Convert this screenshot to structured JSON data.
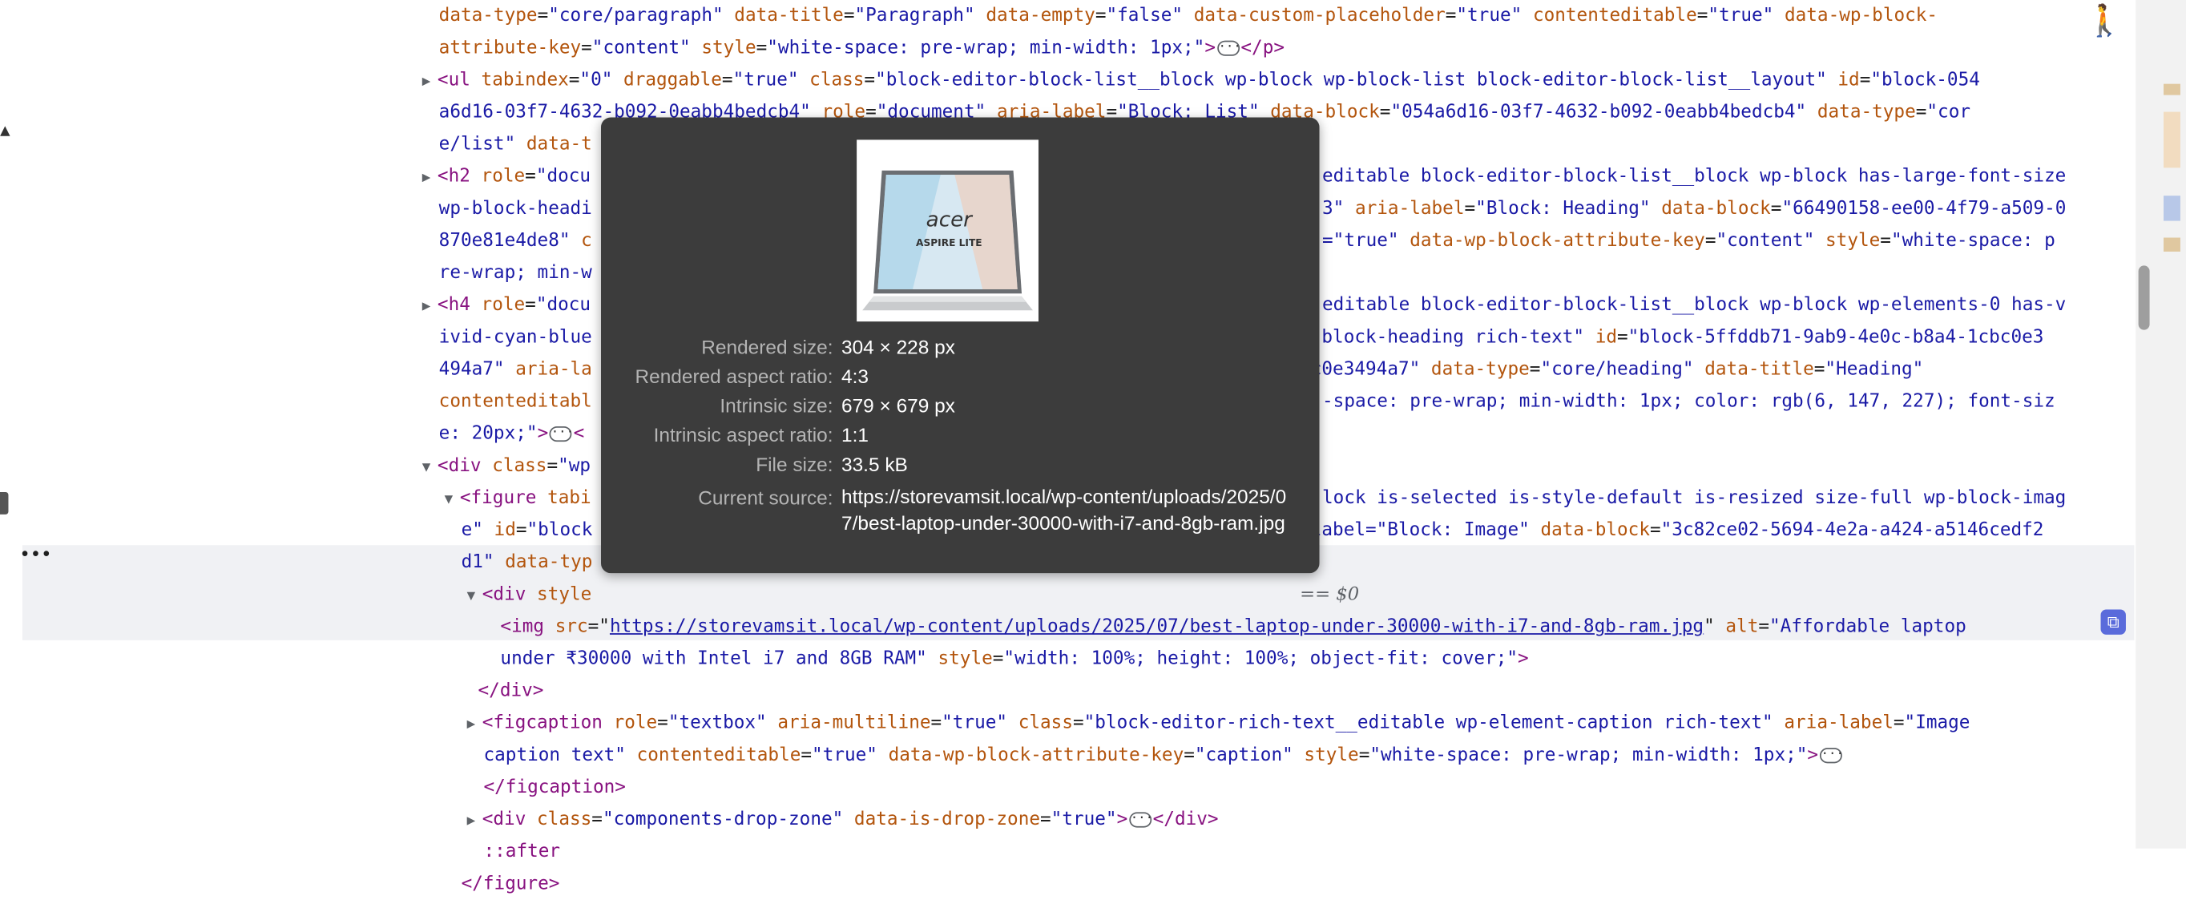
{
  "code": {
    "l1": {
      "a1": "data-type",
      "v1": "\"core/paragraph\"",
      "a2": "data-title",
      "v2": "\"Paragraph\"",
      "a3": "data-empty",
      "v3": "\"false\"",
      "a4": "data-custom-placeholder",
      "v4": "\"true\"",
      "a5": "contenteditable",
      "v5": "\"true\"",
      "a6": "data-wp-block-"
    },
    "l2": {
      "a1": "attribute-key",
      "v1": "\"content\"",
      "a2": "style",
      "v2": "\"white-space: pre-wrap; min-width: 1px;\"",
      "close": "</p>"
    },
    "l3": {
      "tag": "<ul",
      "a1": "tabindex",
      "v1": "\"0\"",
      "a2": "draggable",
      "v2": "\"true\"",
      "a3": "class",
      "v3": "\"block-editor-block-list__block wp-block wp-block-list block-editor-block-list__layout\"",
      "a4": "id",
      "v4": "\"block-054"
    },
    "l4": {
      "v0": "a6d16-03f7-4632-b092-0eabb4bedcb4\"",
      "a1": "role",
      "v1": "\"document\"",
      "a2": "aria-label",
      "v2": "\"Block: List\"",
      "a3": "data-block",
      "v3": "\"054a6d16-03f7-4632-b092-0eabb4bedcb4\"",
      "a4": "data-type",
      "v4": "\"cor"
    },
    "l5": {
      "v0": "e/list\"",
      "a1": "data-t"
    },
    "l6": {
      "tag": "<h2",
      "a1": "role",
      "v1": "\"docu",
      "v2": "editable block-editor-block-list__block wp-block has-large-font-size"
    },
    "l7": {
      "v0": "wp-block-headi",
      "v1": "3\"",
      "a2": "aria-label",
      "v2": "\"Block: Heading\"",
      "a3": "data-block",
      "v3": "\"66490158-ee00-4f79-a509-0"
    },
    "l8": {
      "v0": "870e81e4de8\"",
      "a1": "c",
      "v1": "=\"true\"",
      "a2": "data-wp-block-attribute-key",
      "v2": "\"content\"",
      "a3": "style",
      "v3": "\"white-space: p"
    },
    "l9": {
      "v0": "re-wrap; min-w"
    },
    "l10": {
      "tag": "<h4",
      "a1": "role",
      "v1": "\"docu",
      "v2": "editable block-editor-block-list__block wp-block wp-elements-0 has-v"
    },
    "l11": {
      "v0": "ivid-cyan-blue",
      "v1": "o-block-heading rich-text\"",
      "a2": "id",
      "v2": "\"block-5ffddb71-9ab9-4e0c-b8a4-1cbc0e3"
    },
    "l12": {
      "v0": "494a7\"",
      "a1": "aria-la",
      "v1": "bc0e3494a7\"",
      "a2": "data-type",
      "v2": "\"core/heading\"",
      "a3": "data-title",
      "v3": "\"Heading\""
    },
    "l13": {
      "a0": "contenteditabl",
      "v1": "-space: pre-wrap; min-width: 1px; color: rgb(6, 147, 227); font-siz"
    },
    "l14": {
      "v0": "e: 20px;\"",
      "close": "<"
    },
    "l15": {
      "tag": "<div",
      "a1": "class",
      "v1": "\"wp"
    },
    "l16": {
      "tag": "<figure",
      "a1": "tabi",
      "v1": "lock is-selected is-style-default is-resized size-full wp-block-imag"
    },
    "l17": {
      "v0": "e\"",
      "a1": "id",
      "v1": "\"block",
      "v2": "-label=\"Block: Image\"",
      "a3": "data-block",
      "v3": "\"3c82ce02-5694-4e2a-a424-a5146cedf2"
    },
    "l18": {
      "v0": "d1\"",
      "a1": "data-typ"
    },
    "l19": {
      "tag": "<div",
      "a1": "style",
      "eq": "== $0"
    },
    "l20": {
      "tag": "<img",
      "a1": "src",
      "link": "https://storevamsit.local/wp-content/uploads/2025/07/best-laptop-under-30000-with-i7-and-8gb-ram.jpg",
      "a2": "alt",
      "v2": "\"Affordable laptop"
    },
    "l21": {
      "v0": "under ₹30000 with Intel i7 and 8GB RAM\"",
      "a1": "style",
      "v1": "\"width: 100%; height: 100%; object-fit: cover;\"",
      "close": ">"
    },
    "l22": {
      "close": "</div>"
    },
    "l23": {
      "tag": "<figcaption",
      "a1": "role",
      "v1": "\"textbox\"",
      "a2": "aria-multiline",
      "v2": "\"true\"",
      "a3": "class",
      "v3": "\"block-editor-rich-text__editable wp-element-caption rich-text\"",
      "a4": "aria-label",
      "v4": "\"Image"
    },
    "l24": {
      "v0": "caption text\"",
      "a1": "contenteditable",
      "v1": "\"true\"",
      "a2": "data-wp-block-attribute-key",
      "v2": "\"caption\"",
      "a3": "style",
      "v3": "\"white-space: pre-wrap; min-width: 1px;\""
    },
    "l25": {
      "close": "</figcaption>"
    },
    "l26": {
      "tag": "<div",
      "a1": "class",
      "v1": "\"components-drop-zone\"",
      "a2": "data-is-drop-zone",
      "v2": "\"true\"",
      "close": "</div>"
    },
    "l27": {
      "pe": "::after"
    },
    "l28": {
      "close": "</figure>"
    }
  },
  "dots": "•••",
  "tooltip": {
    "thumb_brand": "acer",
    "thumb_model": "ASPIRE LITE",
    "rows": [
      {
        "label": "Rendered size:",
        "value": "304 × 228 px"
      },
      {
        "label": "Rendered aspect ratio:",
        "value": "4:3"
      },
      {
        "label": "Intrinsic size:",
        "value": "679 × 679 px"
      },
      {
        "label": "Intrinsic aspect ratio:",
        "value": "1:1"
      },
      {
        "label": "File size:",
        "value": "33.5 kB"
      },
      {
        "label": "Current source:",
        "value": ""
      }
    ],
    "source": "https://storevamsit.local/wp-content/uploads/2025/07/best-laptop-under-30000-with-i7-and-8gb-ram.jpg"
  },
  "icons": {
    "accessibility": "accessibility-icon",
    "copy": "copy-icon",
    "ellipsis": "ellipsis-icon"
  },
  "colors": {
    "attr_name": "#b3550d",
    "attr_value": "#1a1aa6",
    "tag": "#881280",
    "tooltip_bg": "#3c3c3c",
    "selection": "#f0f1f4"
  }
}
